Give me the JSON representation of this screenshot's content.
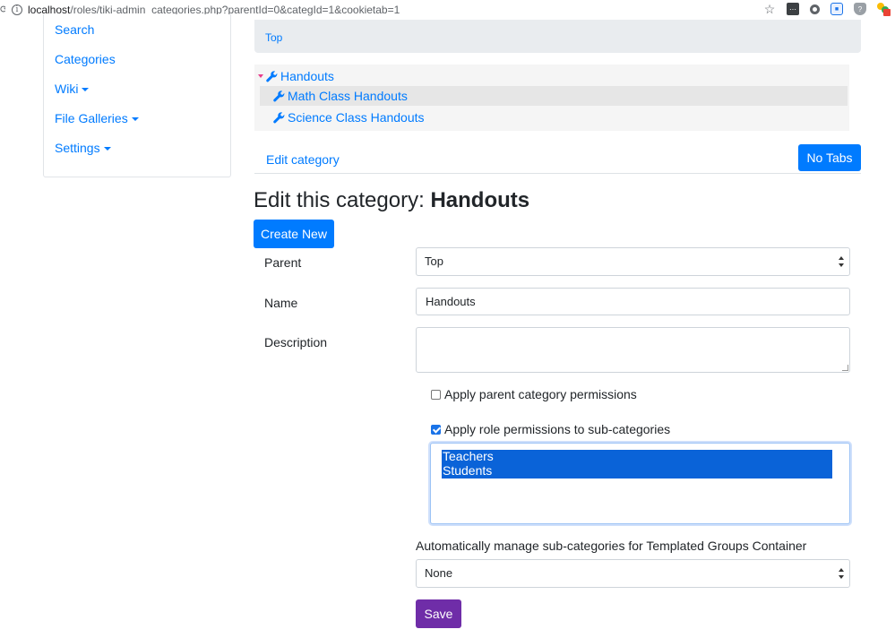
{
  "browser": {
    "url_host": "localhost",
    "url_path": "/roles/tiki-admin_categories.php?parentId=0&categId=1&cookietab=1"
  },
  "sidebar": {
    "items": [
      {
        "label": "Search",
        "dropdown": false
      },
      {
        "label": "Categories",
        "dropdown": false
      },
      {
        "label": "Wiki",
        "dropdown": true
      },
      {
        "label": "File Galleries",
        "dropdown": true
      },
      {
        "label": "Settings",
        "dropdown": true
      }
    ]
  },
  "breadcrumb": {
    "top": "Top"
  },
  "tree": {
    "root": "Handouts",
    "children": [
      "Math Class Handouts",
      "Science Class Handouts"
    ]
  },
  "tabs": {
    "edit_category": "Edit category",
    "no_tabs": "No Tabs"
  },
  "heading": {
    "prefix": "Edit this category: ",
    "name": "Handouts"
  },
  "form": {
    "create_new": "Create New",
    "parent_label": "Parent",
    "parent_value": "Top",
    "name_label": "Name",
    "name_value": "Handouts",
    "description_label": "Description",
    "apply_parent_perms": "Apply parent category permissions",
    "apply_parent_checked": false,
    "apply_role_perms": "Apply role permissions to sub-categories",
    "apply_role_checked": true,
    "roles": [
      "Teachers",
      "Students"
    ],
    "auto_manage_label": "Automatically manage sub-categories for Templated Groups Container",
    "auto_manage_value": "None",
    "save": "Save"
  },
  "colors": {
    "link": "#007bff",
    "primary_button": "#007bff",
    "save_button": "#6f2da8",
    "selection": "#0a63d8"
  }
}
